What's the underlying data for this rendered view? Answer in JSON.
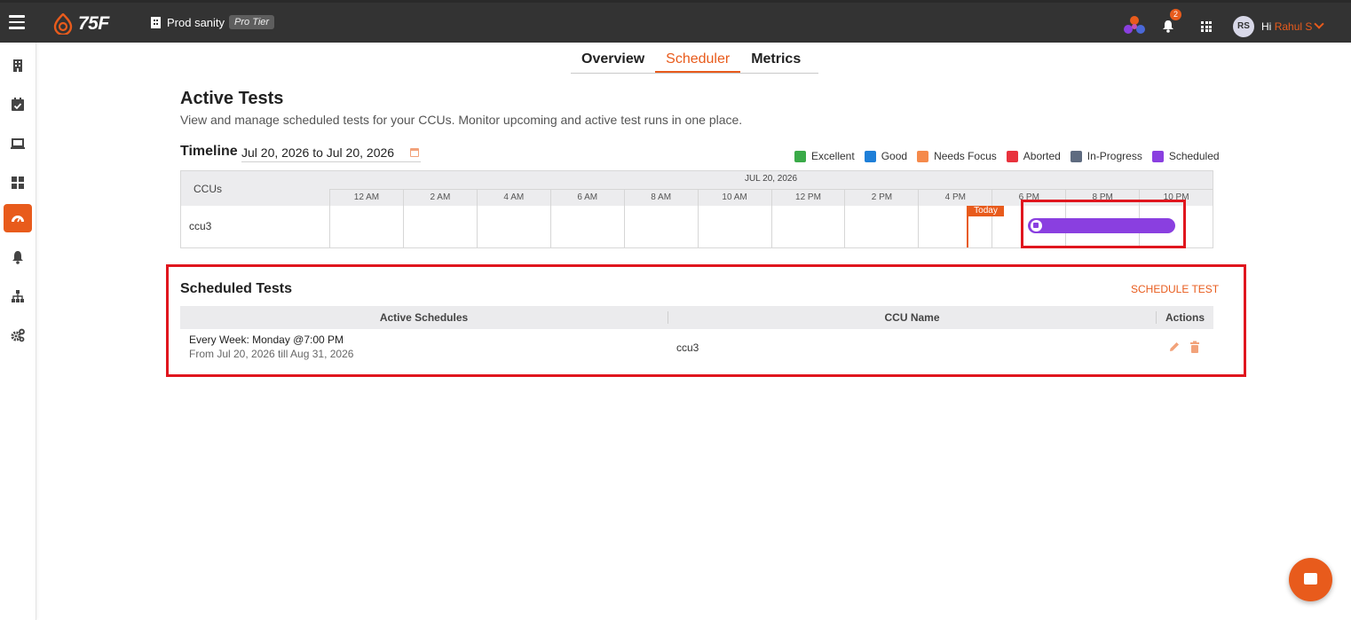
{
  "header": {
    "logo_text": "75F",
    "site_name": "Prod sanity",
    "tier_badge": "Pro Tier",
    "notification_count": "2",
    "user_initials": "RS",
    "greeting": "Hi",
    "user_name": "Rahul S"
  },
  "sidebar": {
    "items": [
      {
        "icon": "building-icon",
        "active": false
      },
      {
        "icon": "calendar-check-icon",
        "active": false
      },
      {
        "icon": "laptop-icon",
        "active": false
      },
      {
        "icon": "dashboard-grid-icon",
        "active": false
      },
      {
        "icon": "speedometer-icon",
        "active": true
      },
      {
        "icon": "bell-icon",
        "active": false
      },
      {
        "icon": "sitemap-icon",
        "active": false
      },
      {
        "icon": "gears-icon",
        "active": false
      }
    ]
  },
  "tabs": [
    {
      "label": "Overview",
      "active": false
    },
    {
      "label": "Scheduler",
      "active": true
    },
    {
      "label": "Metrics",
      "active": false
    }
  ],
  "page": {
    "title": "Active Tests",
    "subtitle": "View and manage scheduled tests for your CCUs. Monitor upcoming and active test runs in one place."
  },
  "timeline": {
    "label": "Timeline",
    "range_start": "Jul 20, 2026",
    "range_separator": "to",
    "range_end": "Jul 20, 2026",
    "legend": [
      {
        "label": "Excellent",
        "color": "#3aaa48"
      },
      {
        "label": "Good",
        "color": "#1e7fd8"
      },
      {
        "label": "Needs Focus",
        "color": "#f58a4b"
      },
      {
        "label": "Aborted",
        "color": "#e8323d"
      },
      {
        "label": "In-Progress",
        "color": "#5e6b80"
      },
      {
        "label": "Scheduled",
        "color": "#8a3fe0"
      }
    ],
    "ccus_header": "CCUs",
    "date_header": "JUL 20, 2026",
    "hours": [
      "12 AM",
      "2 AM",
      "4 AM",
      "6 AM",
      "8 AM",
      "10 AM",
      "12 PM",
      "2 PM",
      "4 PM",
      "6 PM",
      "8 PM",
      "10 PM"
    ],
    "rows": [
      {
        "ccu": "ccu3"
      }
    ],
    "today_label": "Today"
  },
  "scheduled_tests": {
    "title": "Scheduled Tests",
    "schedule_button": "SCHEDULE TEST",
    "columns": [
      "Active Schedules",
      "CCU Name",
      "Actions"
    ],
    "rows": [
      {
        "schedule": "Every Week: Monday @7:00 PM",
        "range": "From Jul 20, 2026 till Aug 31, 2026",
        "ccu_name": "ccu3"
      }
    ]
  },
  "colors": {
    "accent": "#e85b1c",
    "topbar": "#333333",
    "highlight": "#e0161e"
  }
}
